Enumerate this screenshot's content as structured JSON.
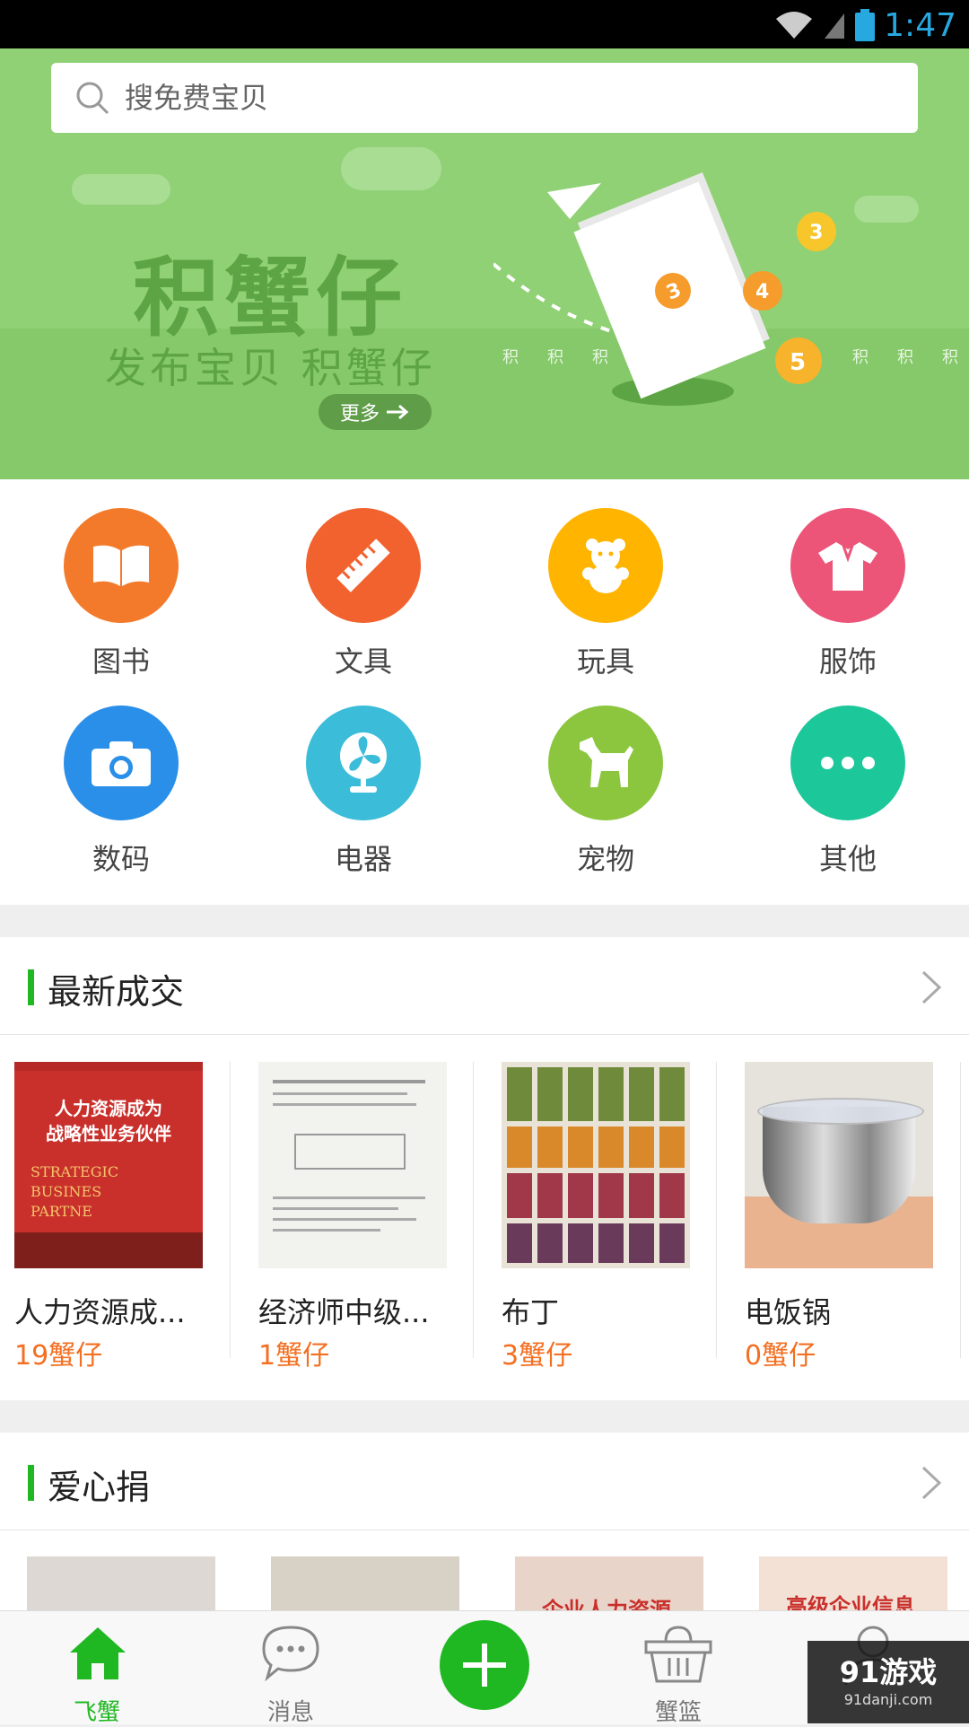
{
  "status_bar": {
    "time": "1:47",
    "time_color": "#27a8e0"
  },
  "search": {
    "placeholder": "搜免费宝贝"
  },
  "banner": {
    "title": "积蟹仔",
    "subtitle": "发布宝贝  积蟹仔",
    "more_label": "更多",
    "coin_labels": [
      "积",
      "积",
      "积",
      "积",
      "积",
      "积"
    ],
    "coins": [
      "3",
      "4",
      "5",
      "3"
    ],
    "page_count": 4,
    "active_index": 3
  },
  "categories": [
    {
      "label": "图书",
      "icon": "book-icon",
      "color": "#f37a2a"
    },
    {
      "label": "文具",
      "icon": "ruler-icon",
      "color": "#f2622e"
    },
    {
      "label": "玩具",
      "icon": "teddy-bear-icon",
      "color": "#ffb400"
    },
    {
      "label": "服饰",
      "icon": "shirt-icon",
      "color": "#ec5578"
    },
    {
      "label": "数码",
      "icon": "camera-icon",
      "color": "#2a8fe9"
    },
    {
      "label": "电器",
      "icon": "fan-icon",
      "color": "#3bbcd9"
    },
    {
      "label": "宠物",
      "icon": "dog-icon",
      "color": "#8cc63f"
    },
    {
      "label": "其他",
      "icon": "more-dots-icon",
      "color": "#1cc79a"
    }
  ],
  "latest_deals": {
    "title": "最新成交",
    "items": [
      {
        "title": "人力资源成...",
        "price": "19蟹仔"
      },
      {
        "title": "经济师中级...",
        "price": "1蟹仔"
      },
      {
        "title": "布丁",
        "price": "3蟹仔"
      },
      {
        "title": "电饭锅",
        "price": "0蟹仔"
      }
    ]
  },
  "book_cover": {
    "cn_title_line1": "人力资源成为",
    "cn_title_line2": "战略性业务伙伴",
    "en_line1": "STRATEGIC",
    "en_line2": "BUSINES",
    "en_line3": "PARTNE"
  },
  "donation": {
    "title": "爱心捐",
    "preview_texts": [
      "企业人力资源",
      "高级企业信息"
    ]
  },
  "bottom_nav": {
    "home": "飞蟹",
    "messages": "消息",
    "basket": "蟹篮",
    "accent": "#1fb822"
  },
  "watermark": {
    "logo": "91游戏",
    "url": "91danji.com"
  }
}
